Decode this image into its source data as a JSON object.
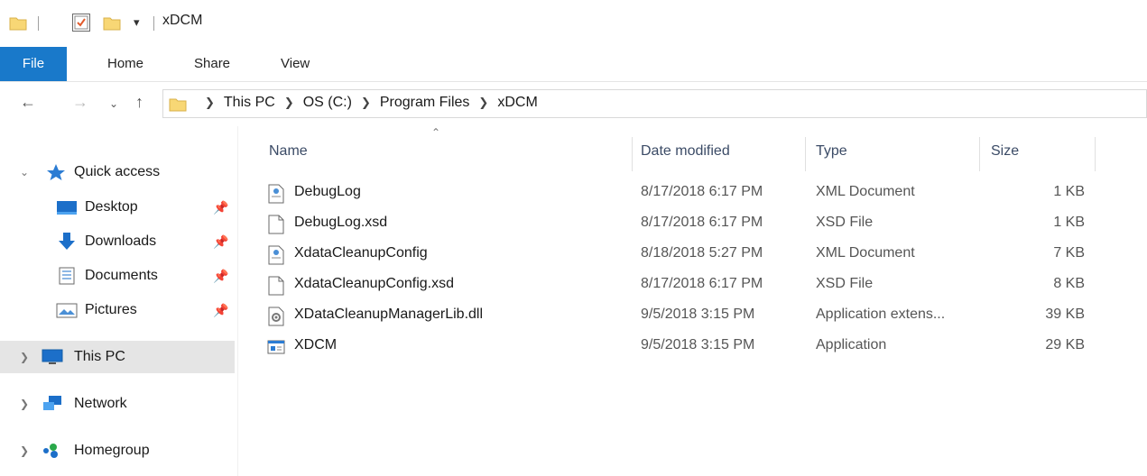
{
  "window": {
    "title": "xDCM"
  },
  "ribbon": {
    "tabs": [
      "File",
      "Home",
      "Share",
      "View"
    ]
  },
  "address": {
    "crumbs": [
      "This PC",
      "OS (C:)",
      "Program Files",
      "xDCM"
    ]
  },
  "sidebar": {
    "quick_access": "Quick access",
    "pinned": [
      {
        "label": "Desktop",
        "icon": "desktop-icon"
      },
      {
        "label": "Downloads",
        "icon": "download-icon"
      },
      {
        "label": "Documents",
        "icon": "documents-icon"
      },
      {
        "label": "Pictures",
        "icon": "pictures-icon"
      }
    ],
    "this_pc": "This PC",
    "network": "Network",
    "homegroup": "Homegroup"
  },
  "columns": {
    "name": "Name",
    "date": "Date modified",
    "type": "Type",
    "size": "Size"
  },
  "files": [
    {
      "name": "DebugLog",
      "date": "8/17/2018 6:17 PM",
      "type": "XML Document",
      "size": "1 KB",
      "icon": "xml-document-icon"
    },
    {
      "name": "DebugLog.xsd",
      "date": "8/17/2018 6:17 PM",
      "type": "XSD File",
      "size": "1 KB",
      "icon": "blank-file-icon"
    },
    {
      "name": "XdataCleanupConfig",
      "date": "8/18/2018 5:27 PM",
      "type": "XML Document",
      "size": "7 KB",
      "icon": "xml-document-icon"
    },
    {
      "name": "XdataCleanupConfig.xsd",
      "date": "8/17/2018 6:17 PM",
      "type": "XSD File",
      "size": "8 KB",
      "icon": "blank-file-icon"
    },
    {
      "name": "XDataCleanupManagerLib.dll",
      "date": "9/5/2018 3:15 PM",
      "type": "Application extens...",
      "size": "39 KB",
      "icon": "dll-file-icon"
    },
    {
      "name": "XDCM",
      "date": "9/5/2018 3:15 PM",
      "type": "Application",
      "size": "29 KB",
      "icon": "application-icon"
    }
  ],
  "colors": {
    "file_tab": "#1979ca",
    "folder": "#f5d56a",
    "selected_nav": "#e5e5e5",
    "header_text": "#3b4b66"
  }
}
